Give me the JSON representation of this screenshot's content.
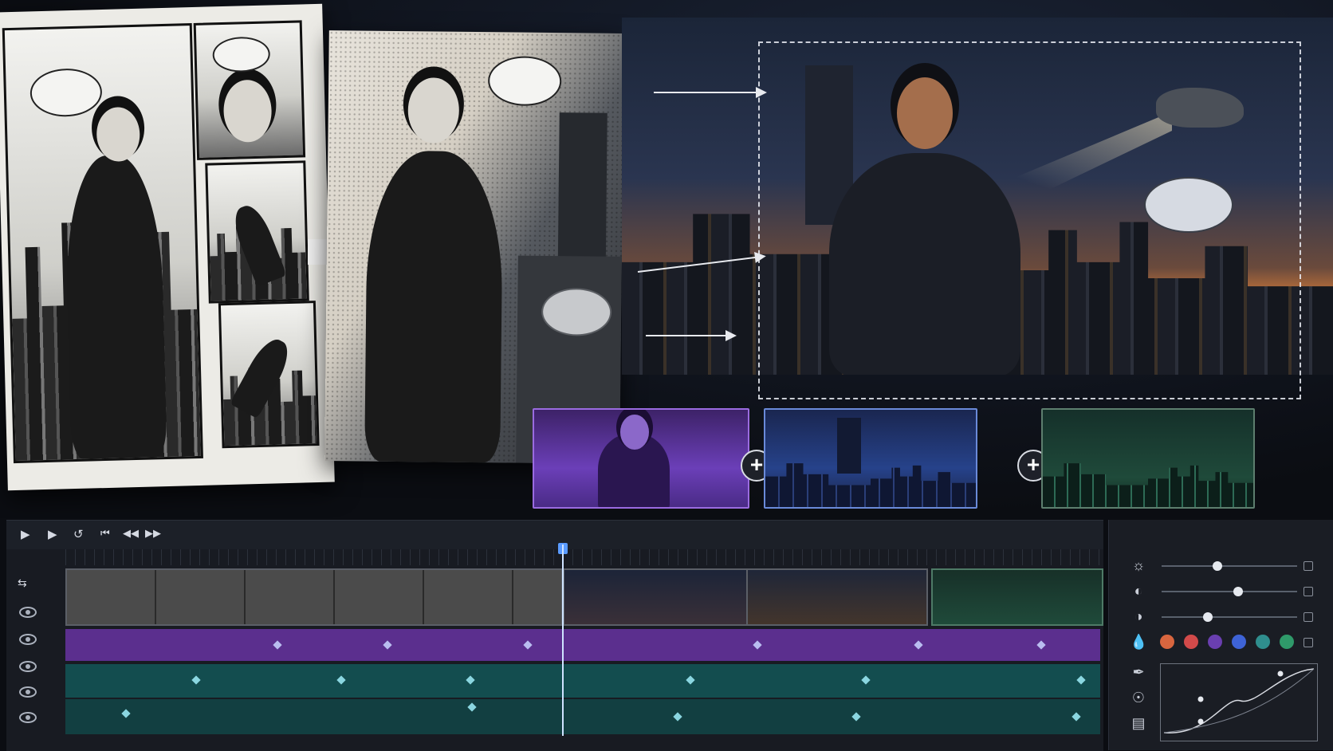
{
  "stage": {
    "comic_page_label": "",
    "panel_count": 5
  },
  "layers": [
    {
      "name": "",
      "tint": "#6b3fb8"
    },
    {
      "name": "",
      "tint": "#26428a"
    },
    {
      "name": "",
      "tint": "#1f4a3a"
    }
  ],
  "transport": {
    "icons": [
      "step-back-icon",
      "play-icon",
      "loop-icon",
      "rewind-icon",
      "prev-frame-icon",
      "fast-forward-icon"
    ]
  },
  "timeline": {
    "tracks": [
      {
        "kind": "video",
        "color": "#2a2f38"
      },
      {
        "kind": "fx",
        "color": "#5b2f8e"
      },
      {
        "kind": "audio-1",
        "color": "#134d4f"
      },
      {
        "kind": "audio-2",
        "color": "#134d4f"
      }
    ],
    "clips": [
      {
        "label": "",
        "color": "#3a3a3a"
      },
      {
        "label": "",
        "color": "#2a3044"
      },
      {
        "label": "",
        "color": "#1f3a2e"
      }
    ],
    "playhead_fraction": 0.48
  },
  "color_panel": {
    "sliders": [
      {
        "name": "brightness",
        "value": 0.4
      },
      {
        "name": "contrast",
        "value": 0.55
      },
      {
        "name": "shadows",
        "value": 0.33
      }
    ],
    "swatches": [
      "#d9663f",
      "#d24a4a",
      "#6a3fb0",
      "#3e63d6",
      "#2f8e8e",
      "#2f9a6a"
    ],
    "icons": [
      "brightness-icon",
      "contrast-icon",
      "shadow-icon",
      "tint-icon",
      "eyedropper-icon",
      "compass-icon",
      "notes-icon"
    ]
  }
}
